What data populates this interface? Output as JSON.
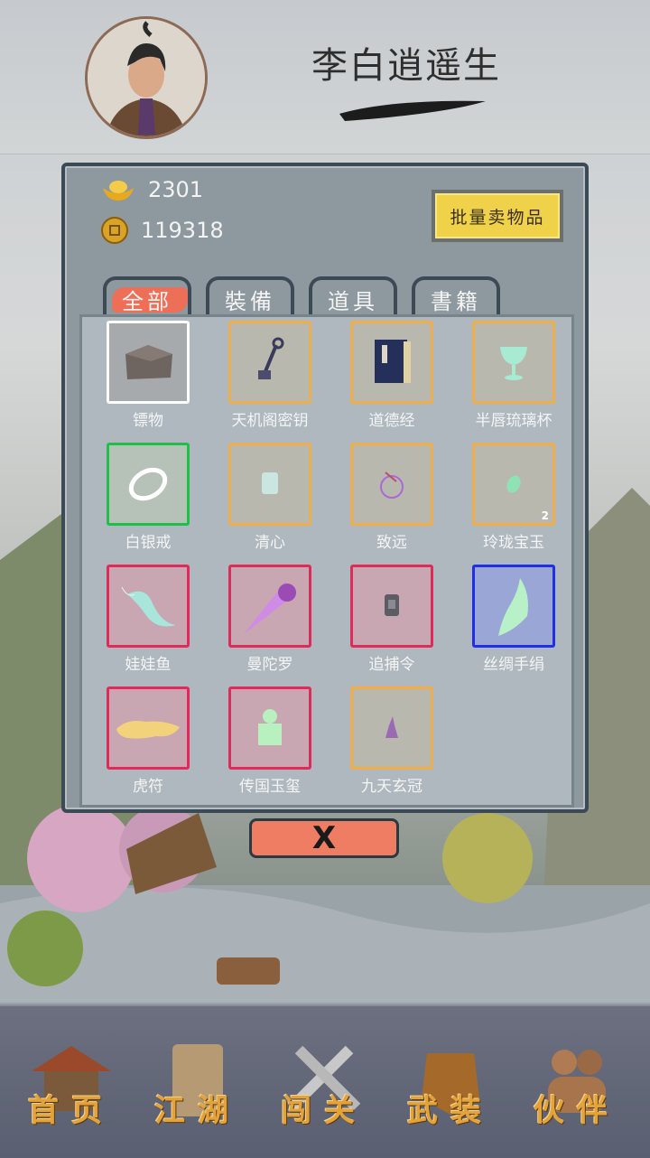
{
  "header": {
    "player_name": "李白逍遥生",
    "avatar_icon": "character-portrait-icon"
  },
  "currency": {
    "gold_ingot": "2301",
    "copper_coin": "119318"
  },
  "sell_button": "批量卖物品",
  "tabs": [
    {
      "label": "全部",
      "active": true
    },
    {
      "label": "裝備",
      "active": false
    },
    {
      "label": "道具",
      "active": false
    },
    {
      "label": "書籍",
      "active": false
    }
  ],
  "items": [
    {
      "name": "镖物",
      "rarity": "white",
      "icon": "cargo-box-icon"
    },
    {
      "name": "天机阁密钥",
      "rarity": "orange",
      "icon": "key-icon"
    },
    {
      "name": "道德经",
      "rarity": "orange",
      "icon": "book-icon"
    },
    {
      "name": "半唇琉璃杯",
      "rarity": "orange",
      "icon": "goblet-icon"
    },
    {
      "name": "白银戒",
      "rarity": "green",
      "icon": "ring-icon"
    },
    {
      "name": "清心",
      "rarity": "orange",
      "icon": "cup-icon"
    },
    {
      "name": "致远",
      "rarity": "orange",
      "icon": "orb-icon"
    },
    {
      "name": "玲珑宝玉",
      "rarity": "orange",
      "icon": "jade-icon",
      "count": "2"
    },
    {
      "name": "娃娃鱼",
      "rarity": "red",
      "icon": "fish-icon"
    },
    {
      "name": "曼陀罗",
      "rarity": "red",
      "icon": "flower-icon"
    },
    {
      "name": "追捕令",
      "rarity": "red",
      "icon": "token-icon"
    },
    {
      "name": "丝绸手绢",
      "rarity": "blue",
      "icon": "silk-icon"
    },
    {
      "name": "虎符",
      "rarity": "red",
      "icon": "tiger-tally-icon"
    },
    {
      "name": "传国玉玺",
      "rarity": "red",
      "icon": "seal-icon"
    },
    {
      "name": "九天玄冠",
      "rarity": "orange",
      "icon": "crown-icon"
    }
  ],
  "close_button": "X",
  "bottom_nav": [
    {
      "label": "首页",
      "icon": "house-icon"
    },
    {
      "label": "江湖",
      "icon": "scroll-icon"
    },
    {
      "label": "闯关",
      "icon": "crossed-swords-icon"
    },
    {
      "label": "武装",
      "icon": "armor-icon"
    },
    {
      "label": "伙伴",
      "icon": "companions-icon"
    }
  ],
  "colors": {
    "rarity_white": "#ffffff",
    "rarity_green": "#1fc04a",
    "rarity_orange": "#f0ae4a",
    "rarity_red": "#e02b5a",
    "rarity_blue": "#1f2ee8",
    "active_tab": "#ee6f58",
    "sell_button": "#f0d24a"
  }
}
